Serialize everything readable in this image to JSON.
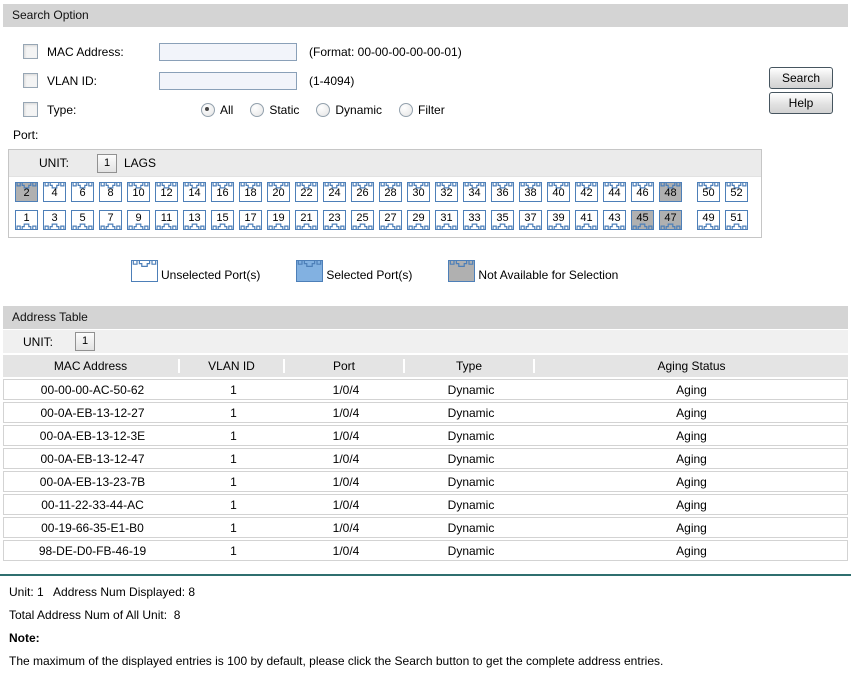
{
  "colors": {
    "port_border": "#4d7fb8",
    "port_selected": "#82b1e1",
    "port_unavailable": "#b0b0b0",
    "divider_teal": "#2f6f6f"
  },
  "search": {
    "title": "Search Option",
    "mac": {
      "label": "MAC Address:",
      "value": "",
      "hint": "(Format: 00-00-00-00-00-01)",
      "checked": false
    },
    "vlan": {
      "label": "VLAN ID:",
      "value": "",
      "hint": "(1-4094)",
      "checked": false
    },
    "type": {
      "label": "Type:",
      "checked": false,
      "options": [
        "All",
        "Static",
        "Dynamic",
        "Filter"
      ],
      "selected": "All"
    },
    "search_button": "Search",
    "help_button": "Help"
  },
  "port": {
    "label": "Port:",
    "unit_label": "UNIT:",
    "unit_value": "1",
    "lags": "LAGS",
    "top_row": [
      2,
      4,
      6,
      8,
      10,
      12,
      14,
      16,
      18,
      20,
      22,
      24,
      26,
      28,
      30,
      32,
      34,
      36,
      38,
      40,
      42,
      44,
      46,
      48,
      50,
      52
    ],
    "bottom_row": [
      1,
      3,
      5,
      7,
      9,
      11,
      13,
      15,
      17,
      19,
      21,
      23,
      25,
      27,
      29,
      31,
      33,
      35,
      37,
      39,
      41,
      43,
      45,
      47,
      49,
      51
    ],
    "unavailable": [
      2,
      45,
      47,
      48
    ],
    "selected": [],
    "gap_before": [
      49,
      50
    ],
    "legend": [
      {
        "label": "Unselected Port(s)",
        "state": "unselected"
      },
      {
        "label": "Selected Port(s)",
        "state": "selected"
      },
      {
        "label": "Not Available for Selection",
        "state": "unavailable"
      }
    ]
  },
  "table": {
    "title": "Address Table",
    "unit_label": "UNIT:",
    "unit_value": "1",
    "columns": [
      "MAC Address",
      "VLAN ID",
      "Port",
      "Type",
      "Aging Status"
    ],
    "rows": [
      [
        "00-00-00-AC-50-62",
        "1",
        "1/0/4",
        "Dynamic",
        "Aging"
      ],
      [
        "00-0A-EB-13-12-27",
        "1",
        "1/0/4",
        "Dynamic",
        "Aging"
      ],
      [
        "00-0A-EB-13-12-3E",
        "1",
        "1/0/4",
        "Dynamic",
        "Aging"
      ],
      [
        "00-0A-EB-13-12-47",
        "1",
        "1/0/4",
        "Dynamic",
        "Aging"
      ],
      [
        "00-0A-EB-13-23-7B",
        "1",
        "1/0/4",
        "Dynamic",
        "Aging"
      ],
      [
        "00-11-22-33-44-AC",
        "1",
        "1/0/4",
        "Dynamic",
        "Aging"
      ],
      [
        "00-19-66-35-E1-B0",
        "1",
        "1/0/4",
        "Dynamic",
        "Aging"
      ],
      [
        "98-DE-D0-FB-46-19",
        "1",
        "1/0/4",
        "Dynamic",
        "Aging"
      ]
    ]
  },
  "footer": {
    "line1": "Unit: 1   Address Num Displayed: 8",
    "line2": "Total Address Num of All Unit:  8",
    "note_label": "Note:",
    "note_text": "The maximum of the displayed entries is 100 by default, please click the Search button to get the complete address entries."
  }
}
